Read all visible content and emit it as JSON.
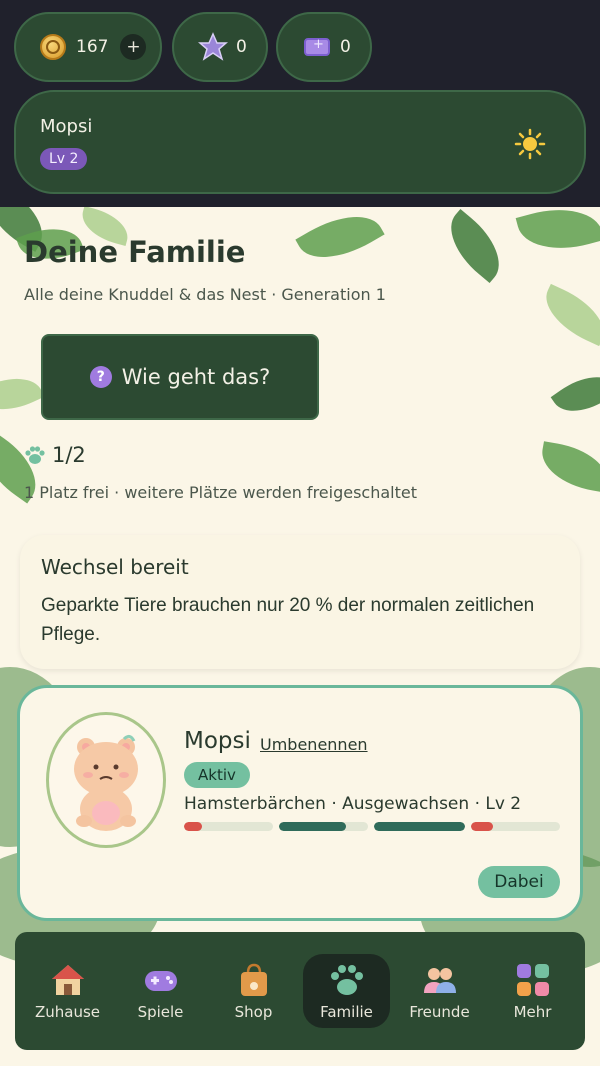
{
  "header": {
    "coins": "167",
    "coins_add": "+",
    "stars": "0",
    "tickets": "0",
    "profile_name": "Mopsi",
    "profile_level": "Lv 2"
  },
  "page": {
    "title": "Deine Familie",
    "subtitle": "Alle deine Knuddel & das Nest · Generation 1",
    "help_button": "Wie geht das?",
    "help_icon": "?",
    "slots": "1/2",
    "slots_note": "1 Platz frei · weitere Plätze werden freigeschaltet"
  },
  "info_card": {
    "title": "Wechsel bereit",
    "text": "Geparkte Tiere brauchen nur 20 % der normalen zeitlichen Pflege."
  },
  "pet": {
    "name": "Mopsi",
    "rename": "Umbenennen",
    "status": "Aktiv",
    "description": "Hamsterbärchen · Ausgewachsen · Lv 2",
    "stats": [
      {
        "fill": 0.2,
        "color": "#d9534a"
      },
      {
        "fill": 0.75,
        "color": "#2f6b5a"
      },
      {
        "fill": 1.0,
        "color": "#2f6b5a"
      },
      {
        "fill": 0.25,
        "color": "#d9534a"
      }
    ],
    "action": "Dabei"
  },
  "nav": {
    "items": [
      {
        "label": "Zuhause",
        "icon": "house-icon"
      },
      {
        "label": "Spiele",
        "icon": "gamepad-icon"
      },
      {
        "label": "Shop",
        "icon": "shopping-bag-icon"
      },
      {
        "label": "Familie",
        "icon": "paw-icon",
        "active": true
      },
      {
        "label": "Freunde",
        "icon": "friends-icon"
      },
      {
        "label": "Mehr",
        "icon": "grid-icon"
      }
    ]
  },
  "colors": {
    "dark_bg": "#20212c",
    "panel_green": "#2c4a32",
    "cream": "#fbf6e7",
    "accent_mint": "#74c0a0",
    "level_purple": "#7b58b8"
  }
}
